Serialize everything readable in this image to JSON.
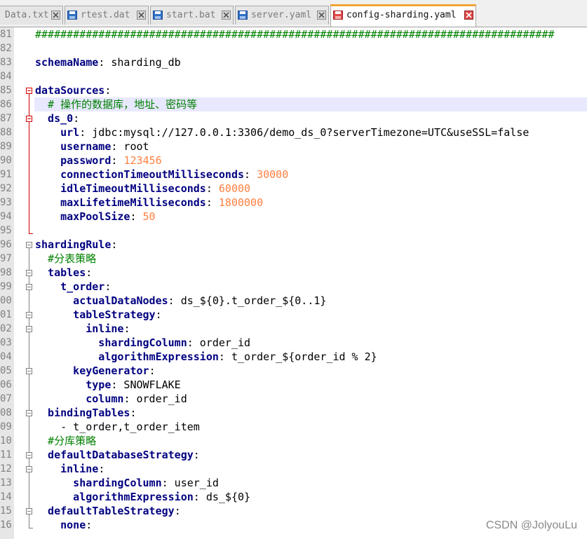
{
  "tabs": [
    {
      "label": "Data.txt",
      "active": false
    },
    {
      "label": "rtest.dat",
      "active": false
    },
    {
      "label": "start.bat",
      "active": false
    },
    {
      "label": "server.yaml",
      "active": false
    },
    {
      "label": "config-sharding.yaml",
      "active": true
    }
  ],
  "editor": {
    "lines": [
      {
        "num": "81",
        "segments": [
          {
            "t": "##################################################################################",
            "c": "h"
          }
        ]
      },
      {
        "num": "82",
        "segments": []
      },
      {
        "num": "83",
        "segments": [
          {
            "t": "schemaName",
            "c": "k"
          },
          {
            "t": ": sharding_db",
            "c": "v"
          }
        ]
      },
      {
        "num": "84",
        "segments": []
      },
      {
        "num": "85",
        "segments": [
          {
            "t": "dataSources",
            "c": "k"
          },
          {
            "t": ":",
            "c": "v"
          }
        ]
      },
      {
        "num": "86",
        "segments": [
          {
            "t": "  # 操作的数据库，地址、密码等",
            "c": "c"
          }
        ]
      },
      {
        "num": "87",
        "segments": [
          {
            "t": "  ds_0",
            "c": "k"
          },
          {
            "t": ":",
            "c": "v"
          }
        ]
      },
      {
        "num": "88",
        "segments": [
          {
            "t": "    url",
            "c": "k"
          },
          {
            "t": ": jdbc:mysql://127.0.0.1:3306/demo_ds_0?serverTimezone=UTC&useSSL=false",
            "c": "v"
          }
        ]
      },
      {
        "num": "89",
        "segments": [
          {
            "t": "    username",
            "c": "k"
          },
          {
            "t": ": root",
            "c": "v"
          }
        ]
      },
      {
        "num": "90",
        "segments": [
          {
            "t": "    password",
            "c": "k"
          },
          {
            "t": ": ",
            "c": "v"
          },
          {
            "t": "123456",
            "c": "n"
          }
        ]
      },
      {
        "num": "91",
        "segments": [
          {
            "t": "    connectionTimeoutMilliseconds",
            "c": "k"
          },
          {
            "t": ": ",
            "c": "v"
          },
          {
            "t": "30000",
            "c": "n"
          }
        ]
      },
      {
        "num": "92",
        "segments": [
          {
            "t": "    idleTimeoutMilliseconds",
            "c": "k"
          },
          {
            "t": ": ",
            "c": "v"
          },
          {
            "t": "60000",
            "c": "n"
          }
        ]
      },
      {
        "num": "93",
        "segments": [
          {
            "t": "    maxLifetimeMilliseconds",
            "c": "k"
          },
          {
            "t": ": ",
            "c": "v"
          },
          {
            "t": "1800000",
            "c": "n"
          }
        ]
      },
      {
        "num": "94",
        "segments": [
          {
            "t": "    maxPoolSize",
            "c": "k"
          },
          {
            "t": ": ",
            "c": "v"
          },
          {
            "t": "50",
            "c": "n"
          }
        ]
      },
      {
        "num": "95",
        "segments": []
      },
      {
        "num": "96",
        "segments": [
          {
            "t": "shardingRule",
            "c": "k"
          },
          {
            "t": ":",
            "c": "v"
          }
        ]
      },
      {
        "num": "97",
        "segments": [
          {
            "t": "  #分表策略",
            "c": "c"
          }
        ]
      },
      {
        "num": "98",
        "segments": [
          {
            "t": "  tables",
            "c": "k"
          },
          {
            "t": ":",
            "c": "v"
          }
        ]
      },
      {
        "num": "99",
        "segments": [
          {
            "t": "    t_order",
            "c": "k"
          },
          {
            "t": ":",
            "c": "v"
          }
        ]
      },
      {
        "num": "00",
        "segments": [
          {
            "t": "      actualDataNodes",
            "c": "k"
          },
          {
            "t": ": ds_${0}.t_order_${0..1}",
            "c": "v"
          }
        ]
      },
      {
        "num": "01",
        "segments": [
          {
            "t": "      tableStrategy",
            "c": "k"
          },
          {
            "t": ":",
            "c": "v"
          }
        ]
      },
      {
        "num": "02",
        "segments": [
          {
            "t": "        inline",
            "c": "k"
          },
          {
            "t": ":",
            "c": "v"
          }
        ]
      },
      {
        "num": "03",
        "segments": [
          {
            "t": "          shardingColumn",
            "c": "k"
          },
          {
            "t": ": order_id",
            "c": "v"
          }
        ]
      },
      {
        "num": "04",
        "segments": [
          {
            "t": "          algorithmExpression",
            "c": "k"
          },
          {
            "t": ": t_order_${order_id % 2}",
            "c": "v"
          }
        ]
      },
      {
        "num": "05",
        "segments": [
          {
            "t": "      keyGenerator",
            "c": "k"
          },
          {
            "t": ":",
            "c": "v"
          }
        ]
      },
      {
        "num": "06",
        "segments": [
          {
            "t": "        type",
            "c": "k"
          },
          {
            "t": ": SNOWFLAKE",
            "c": "v"
          }
        ]
      },
      {
        "num": "07",
        "segments": [
          {
            "t": "        column",
            "c": "k"
          },
          {
            "t": ": order_id",
            "c": "v"
          }
        ]
      },
      {
        "num": "08",
        "segments": [
          {
            "t": "  bindingTables",
            "c": "k"
          },
          {
            "t": ":",
            "c": "v"
          }
        ]
      },
      {
        "num": "09",
        "segments": [
          {
            "t": "    - t_order,t_order_item",
            "c": "v"
          }
        ]
      },
      {
        "num": "10",
        "segments": [
          {
            "t": "  #分库策略",
            "c": "c"
          }
        ]
      },
      {
        "num": "11",
        "segments": [
          {
            "t": "  defaultDatabaseStrategy",
            "c": "k"
          },
          {
            "t": ":",
            "c": "v"
          }
        ]
      },
      {
        "num": "12",
        "segments": [
          {
            "t": "    inline",
            "c": "k"
          },
          {
            "t": ":",
            "c": "v"
          }
        ]
      },
      {
        "num": "13",
        "segments": [
          {
            "t": "      shardingColumn",
            "c": "k"
          },
          {
            "t": ": user_id",
            "c": "v"
          }
        ]
      },
      {
        "num": "14",
        "segments": [
          {
            "t": "      algorithmExpression",
            "c": "k"
          },
          {
            "t": ": ds_${0}",
            "c": "v"
          }
        ]
      },
      {
        "num": "15",
        "segments": [
          {
            "t": "  defaultTableStrategy",
            "c": "k"
          },
          {
            "t": ":",
            "c": "v"
          }
        ]
      },
      {
        "num": "16",
        "segments": [
          {
            "t": "    none",
            "c": "k"
          },
          {
            "t": ":",
            "c": "v"
          }
        ]
      }
    ]
  },
  "watermark": "CSDN @JolyouLu",
  "colors": {
    "key": "#000080",
    "number": "#ff8040",
    "comment": "#008000",
    "active_tab_accent": "#f3a535",
    "fold_active": "#d00000",
    "fold_inactive": "#808080"
  }
}
